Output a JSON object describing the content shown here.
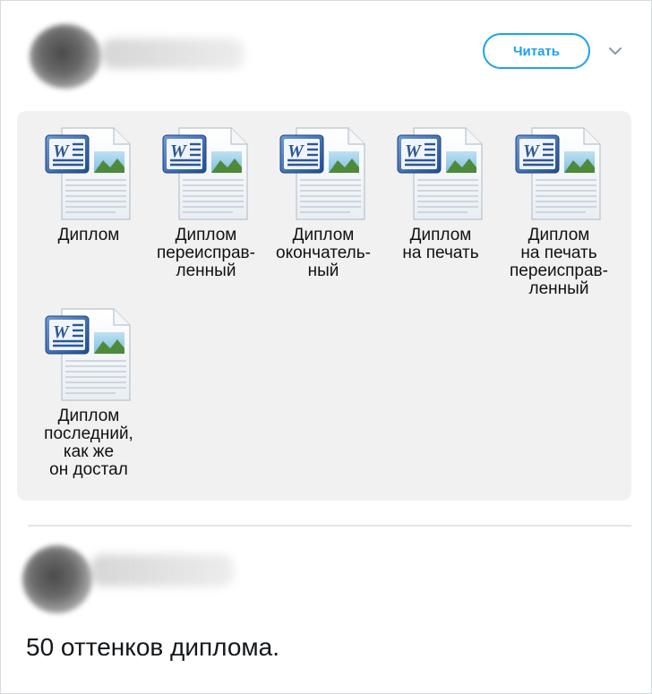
{
  "header": {
    "follow_label": "Читать",
    "caret_icon": "chevron-down-icon"
  },
  "gallery": {
    "icon": "word-document-icon",
    "files": [
      {
        "label": "Диплом"
      },
      {
        "label": "Диплом\nпереисправ-\nленный"
      },
      {
        "label": "Диплом\nокончатель-\nный"
      },
      {
        "label": "Диплом\nна печать"
      },
      {
        "label": "Диплом\nна печать\nпереисправ-\nленный"
      },
      {
        "label": "Диплом\nпоследний,\nкак же\nон достал"
      }
    ]
  },
  "reply": {
    "text": "50 оттенков диплома."
  },
  "colors": {
    "accent": "#1da1f2",
    "gallery_bg": "#f1f1f1",
    "word_blue": "#2b5797"
  }
}
